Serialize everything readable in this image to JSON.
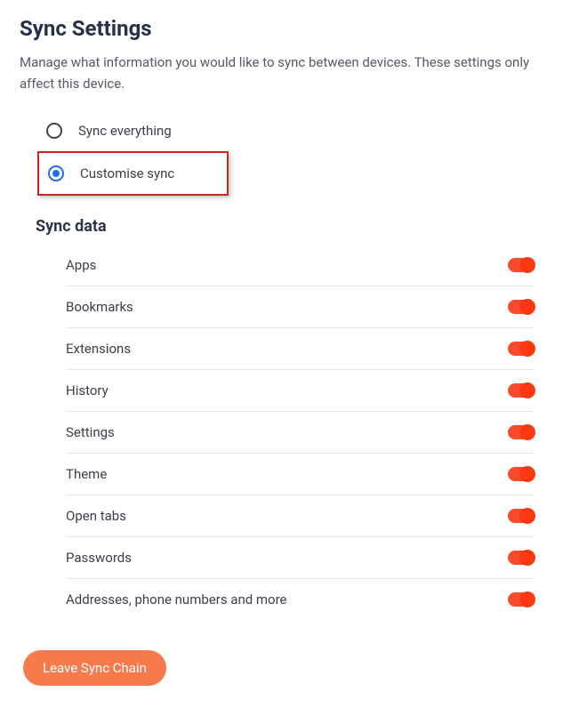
{
  "title": "Sync Settings",
  "description": "Manage what information you would like to sync between devices. These settings only affect this device.",
  "radios": {
    "sync_everything": {
      "label": "Sync everything",
      "selected": false
    },
    "customise_sync": {
      "label": "Customise sync",
      "selected": true
    }
  },
  "section_title": "Sync data",
  "items": [
    {
      "label": "Apps",
      "on": true
    },
    {
      "label": "Bookmarks",
      "on": true
    },
    {
      "label": "Extensions",
      "on": true
    },
    {
      "label": "History",
      "on": true
    },
    {
      "label": "Settings",
      "on": true
    },
    {
      "label": "Theme",
      "on": true
    },
    {
      "label": "Open tabs",
      "on": true
    },
    {
      "label": "Passwords",
      "on": true
    },
    {
      "label": "Addresses, phone numbers and more",
      "on": true
    }
  ],
  "leave_button": "Leave Sync Chain",
  "colors": {
    "accent": "#f77a4c",
    "toggle_track": "#f94a2c",
    "toggle_knob": "#fa3913",
    "radio_selected": "#1f6cf0",
    "highlight_border": "#c62828"
  }
}
